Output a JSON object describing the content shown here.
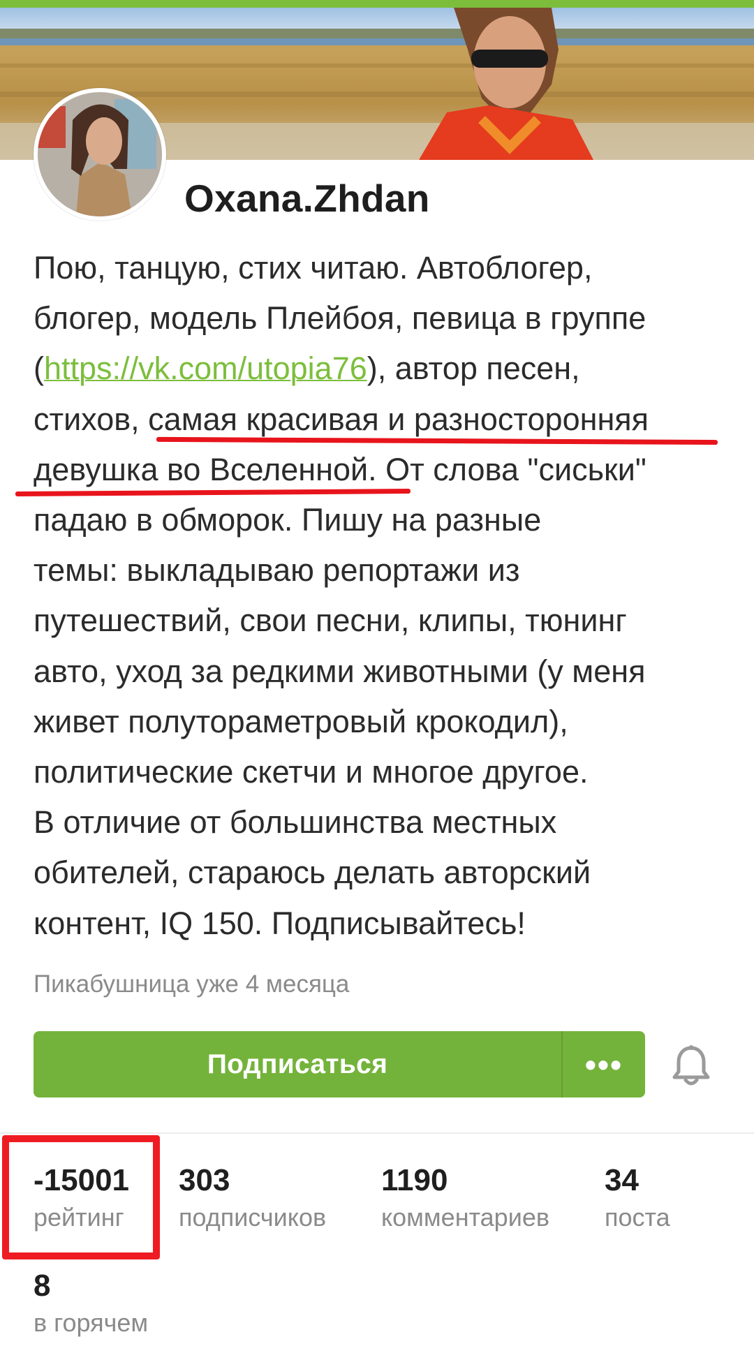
{
  "profile": {
    "username": "Oxana.Zhdan",
    "bio_lines": [
      "Пою, танцую, стих читаю. Автоблогер,",
      "блогер, модель Плейбоя, певица в группе",
      {
        "before": "(",
        "link": "https://vk.com/utopia76",
        "after": "), автор песен,"
      },
      "стихов, самая красивая и разносторонняя",
      "девушка во Вселенной. От слова \"сиськи\"",
      "падаю в обморок. Пишу на разные",
      "темы: выкладываю репортажи из",
      "путешествий, свои песни, клипы, тюнинг",
      "авто, уход за редкими животными (у меня",
      "живет полутораметровый крокодил),",
      "политические скетчи и многое другое.",
      "В отличие от большинства местных",
      "обителей, стараюсь делать авторский",
      "контент, IQ 150. Подписывайтесь!"
    ],
    "since": "Пикабушница уже 4 месяца"
  },
  "actions": {
    "subscribe_label": "Подписаться",
    "more_label": "•••",
    "bell_icon": "bell-icon"
  },
  "stats": [
    {
      "value": "-15001",
      "label": "рейтинг"
    },
    {
      "value": "303",
      "label": "подписчиков"
    },
    {
      "value": "1190",
      "label": "комментариев"
    },
    {
      "value": "34",
      "label": "поста"
    },
    {
      "value": "8",
      "label": "в горячем"
    }
  ],
  "colors": {
    "accent": "#74b33b",
    "link": "#7cbe3c",
    "annotation_red": "#e8141c"
  }
}
